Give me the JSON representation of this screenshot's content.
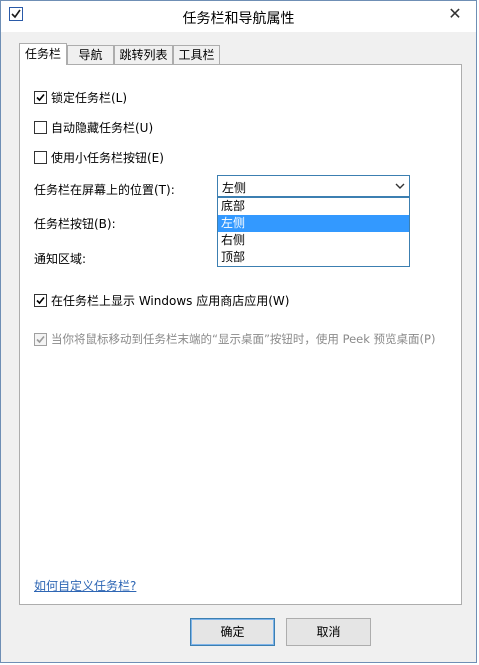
{
  "window": {
    "title": "任务栏和导航属性",
    "close_glyph": "✕"
  },
  "tabs": [
    {
      "label": "任务栏",
      "active": true
    },
    {
      "label": "导航",
      "active": false
    },
    {
      "label": "跳转列表",
      "active": false
    },
    {
      "label": "工具栏",
      "active": false
    }
  ],
  "options": {
    "lock": {
      "label": "锁定任务栏(L)",
      "checked": true
    },
    "autohide": {
      "label": "自动隐藏任务栏(U)",
      "checked": false
    },
    "small_buttons": {
      "label": "使用小任务栏按钮(E)",
      "checked": false
    },
    "position_label": "任务栏在屏幕上的位置(T):",
    "buttons_label": "任务栏按钮(B):",
    "notify_label": "通知区域:",
    "show_store": {
      "label": "在任务栏上显示 Windows 应用商店应用(W)",
      "checked": true
    },
    "peek": {
      "label": "当你将鼠标移动到任务栏末端的“显示桌面”按钮时，使用 Peek 预览桌面(P)",
      "checked": true,
      "disabled": true
    }
  },
  "position_select": {
    "value": "左侧",
    "items": [
      "底部",
      "左侧",
      "右侧",
      "顶部"
    ],
    "selected_index": 1
  },
  "help_link": "如何自定义任务栏?",
  "buttons": {
    "ok": "确定",
    "cancel": "取消"
  }
}
